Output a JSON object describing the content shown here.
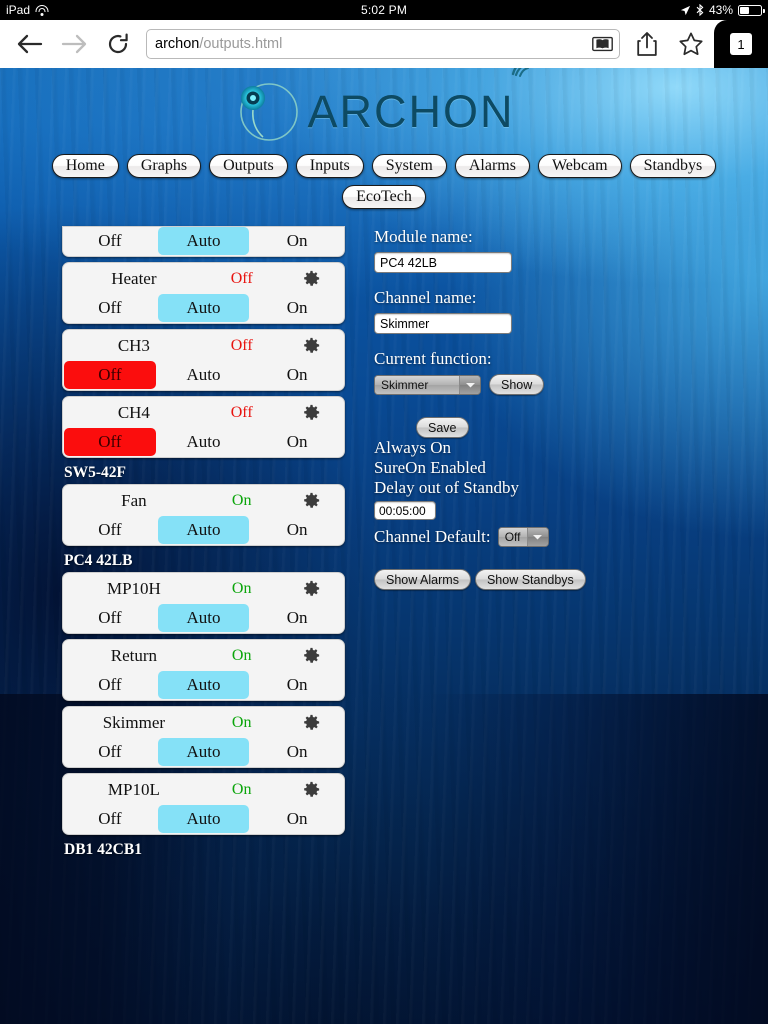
{
  "status_bar": {
    "carrier": "iPad",
    "wifi_icon": "wifi-icon",
    "time": "5:02 PM",
    "location_icon": "location-arrow-icon",
    "bluetooth_icon": "bluetooth-icon",
    "battery_percent": "43%",
    "battery_level": 43
  },
  "browser": {
    "back_icon": "back-arrow-icon",
    "forward_icon": "forward-arrow-icon",
    "reload_icon": "reload-icon",
    "url_prefix": "archon",
    "url_suffix": "/outputs.html",
    "url_full": "archon/outputs.html",
    "reader_icon": "reader-view-icon",
    "share_icon": "share-icon",
    "bookmark_icon": "bookmark-star-icon",
    "tab_count": "1"
  },
  "site": {
    "logo_text": "ARCHON",
    "logo_mark_icon": "archon-circle-logo-icon",
    "logo_wifi_icon": "signal-waves-icon"
  },
  "nav": {
    "row1": [
      "Home",
      "Graphs",
      "Outputs",
      "Inputs",
      "System",
      "Alarms",
      "Webcam",
      "Standbys"
    ],
    "row2": [
      "EcoTech"
    ]
  },
  "outputs": {
    "modes": [
      "Off",
      "Auto",
      "On"
    ],
    "items": [
      {
        "kind": "card",
        "clipped": true,
        "name": "",
        "state": "",
        "state_class": "",
        "gear": false,
        "active": "Auto"
      },
      {
        "kind": "card",
        "clipped": false,
        "name": "Heater",
        "state": "Off",
        "state_class": "off",
        "gear": true,
        "active": "Auto"
      },
      {
        "kind": "card",
        "clipped": false,
        "name": "CH3",
        "state": "Off",
        "state_class": "off",
        "gear": true,
        "active": "Off"
      },
      {
        "kind": "card",
        "clipped": false,
        "name": "CH4",
        "state": "Off",
        "state_class": "off",
        "gear": true,
        "active": "Off"
      },
      {
        "kind": "group",
        "label": "SW5-42F"
      },
      {
        "kind": "card",
        "clipped": false,
        "name": "Fan",
        "state": "On",
        "state_class": "on",
        "gear": true,
        "active": "Auto"
      },
      {
        "kind": "group",
        "label": "PC4 42LB"
      },
      {
        "kind": "card",
        "clipped": false,
        "name": "MP10H",
        "state": "On",
        "state_class": "on",
        "gear": true,
        "active": "Auto"
      },
      {
        "kind": "card",
        "clipped": false,
        "name": "Return",
        "state": "On",
        "state_class": "on",
        "gear": true,
        "active": "Auto"
      },
      {
        "kind": "card",
        "clipped": false,
        "name": "Skimmer",
        "state": "On",
        "state_class": "on",
        "gear": true,
        "active": "Auto"
      },
      {
        "kind": "card",
        "clipped": false,
        "name": "MP10L",
        "state": "On",
        "state_class": "on",
        "gear": true,
        "active": "Auto"
      },
      {
        "kind": "group",
        "label": "DB1 42CB1"
      }
    ]
  },
  "details": {
    "module_name_label": "Module name:",
    "module_name_value": "PC4 42LB",
    "channel_name_label": "Channel name:",
    "channel_name_value": "Skimmer",
    "current_function_label": "Current function:",
    "current_function_value": "Skimmer",
    "show_button": "Show",
    "save_button": "Save",
    "always_on": "Always On",
    "sureon_enabled": "SureOn Enabled",
    "delay_out_of_standby": "Delay out of Standby",
    "delay_value": "00:05:00",
    "channel_default_label": "Channel Default:",
    "channel_default_value": "Off",
    "show_alarms_button": "Show Alarms",
    "show_standbys_button": "Show Standbys"
  },
  "colors": {
    "auto_active": "#85e1f7",
    "off_active": "#fb0d0d",
    "state_on": "#0ba50b",
    "state_off": "#e8130f",
    "logo": "#0d4a63"
  }
}
